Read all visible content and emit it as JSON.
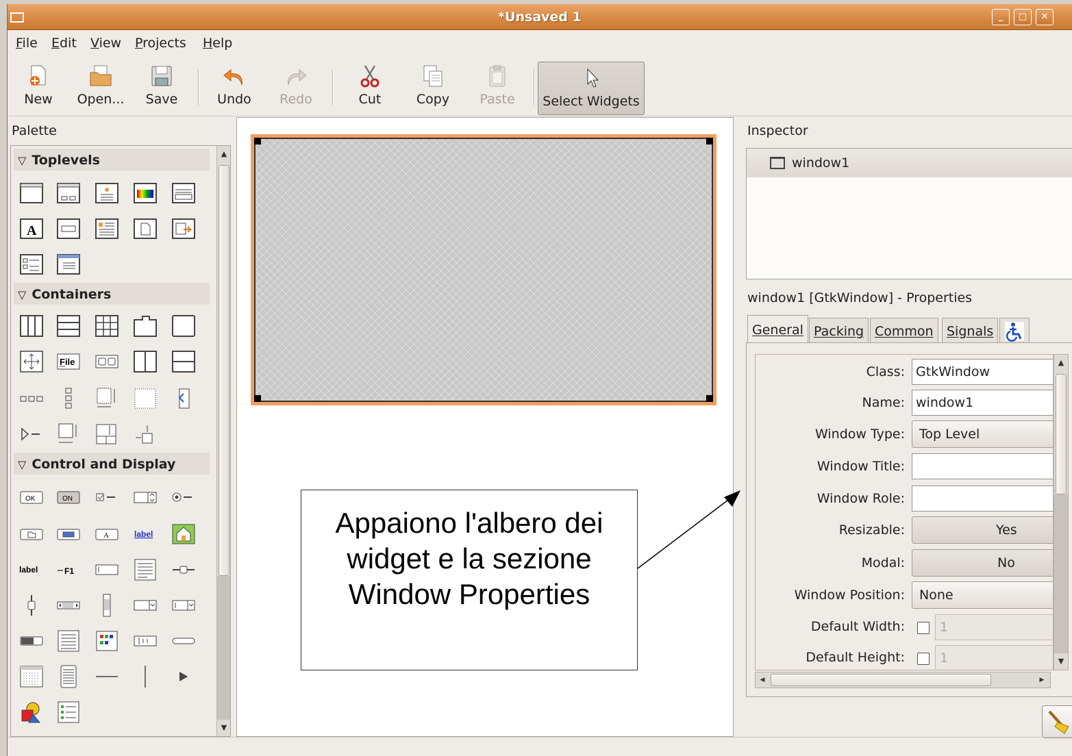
{
  "window": {
    "title": "*Unsaved 1"
  },
  "menu": [
    {
      "label": "File",
      "mnemonic": "F",
      "rest": "ile"
    },
    {
      "label": "Edit",
      "mnemonic": "E",
      "rest": "dit"
    },
    {
      "label": "View",
      "mnemonic": "V",
      "rest": "iew"
    },
    {
      "label": "Projects",
      "mnemonic": "P",
      "rest": "rojects"
    },
    {
      "label": "Help",
      "mnemonic": "H",
      "rest": "elp"
    }
  ],
  "toolbar": {
    "new": "New",
    "open": "Open...",
    "save": "Save",
    "undo": "Undo",
    "redo": "Redo",
    "cut": "Cut",
    "copy": "Copy",
    "paste": "Paste",
    "select": "Select Widgets"
  },
  "palette": {
    "title": "Palette",
    "groups": {
      "toplevels": "Toplevels",
      "containers": "Containers",
      "control": "Control and Display"
    },
    "text_widgets": {
      "file": "File",
      "ok": "OK",
      "on": "ON",
      "label1": "label",
      "label2": "label",
      "f1": "F1",
      "a": "A"
    }
  },
  "callout": {
    "text": "Appaiono l'albero dei widget e la sezione Window Properties"
  },
  "inspector": {
    "title": "Inspector",
    "tree": [
      {
        "label": "window1"
      }
    ]
  },
  "properties": {
    "title": "window1 [GtkWindow] - Properties",
    "tabs": [
      "General",
      "Packing",
      "Common",
      "Signals"
    ],
    "fields": {
      "class_label": "Class:",
      "class_value": "GtkWindow",
      "name_label": "Name:",
      "name_value": "window1",
      "type_label": "Window Type:",
      "type_value": "Top Level",
      "title_label": "Window Title:",
      "title_value": "",
      "role_label": "Window Role:",
      "role_value": "",
      "resizable_label": "Resizable:",
      "resizable_value": "Yes",
      "modal_label": "Modal:",
      "modal_value": "No",
      "position_label": "Window Position:",
      "position_value": "None",
      "width_label": "Default Width:",
      "width_value": "1",
      "height_label": "Default Height:",
      "height_value": "1"
    }
  },
  "colors": {
    "titlebar": "#d98a45",
    "selection_border": "#f0a060"
  }
}
